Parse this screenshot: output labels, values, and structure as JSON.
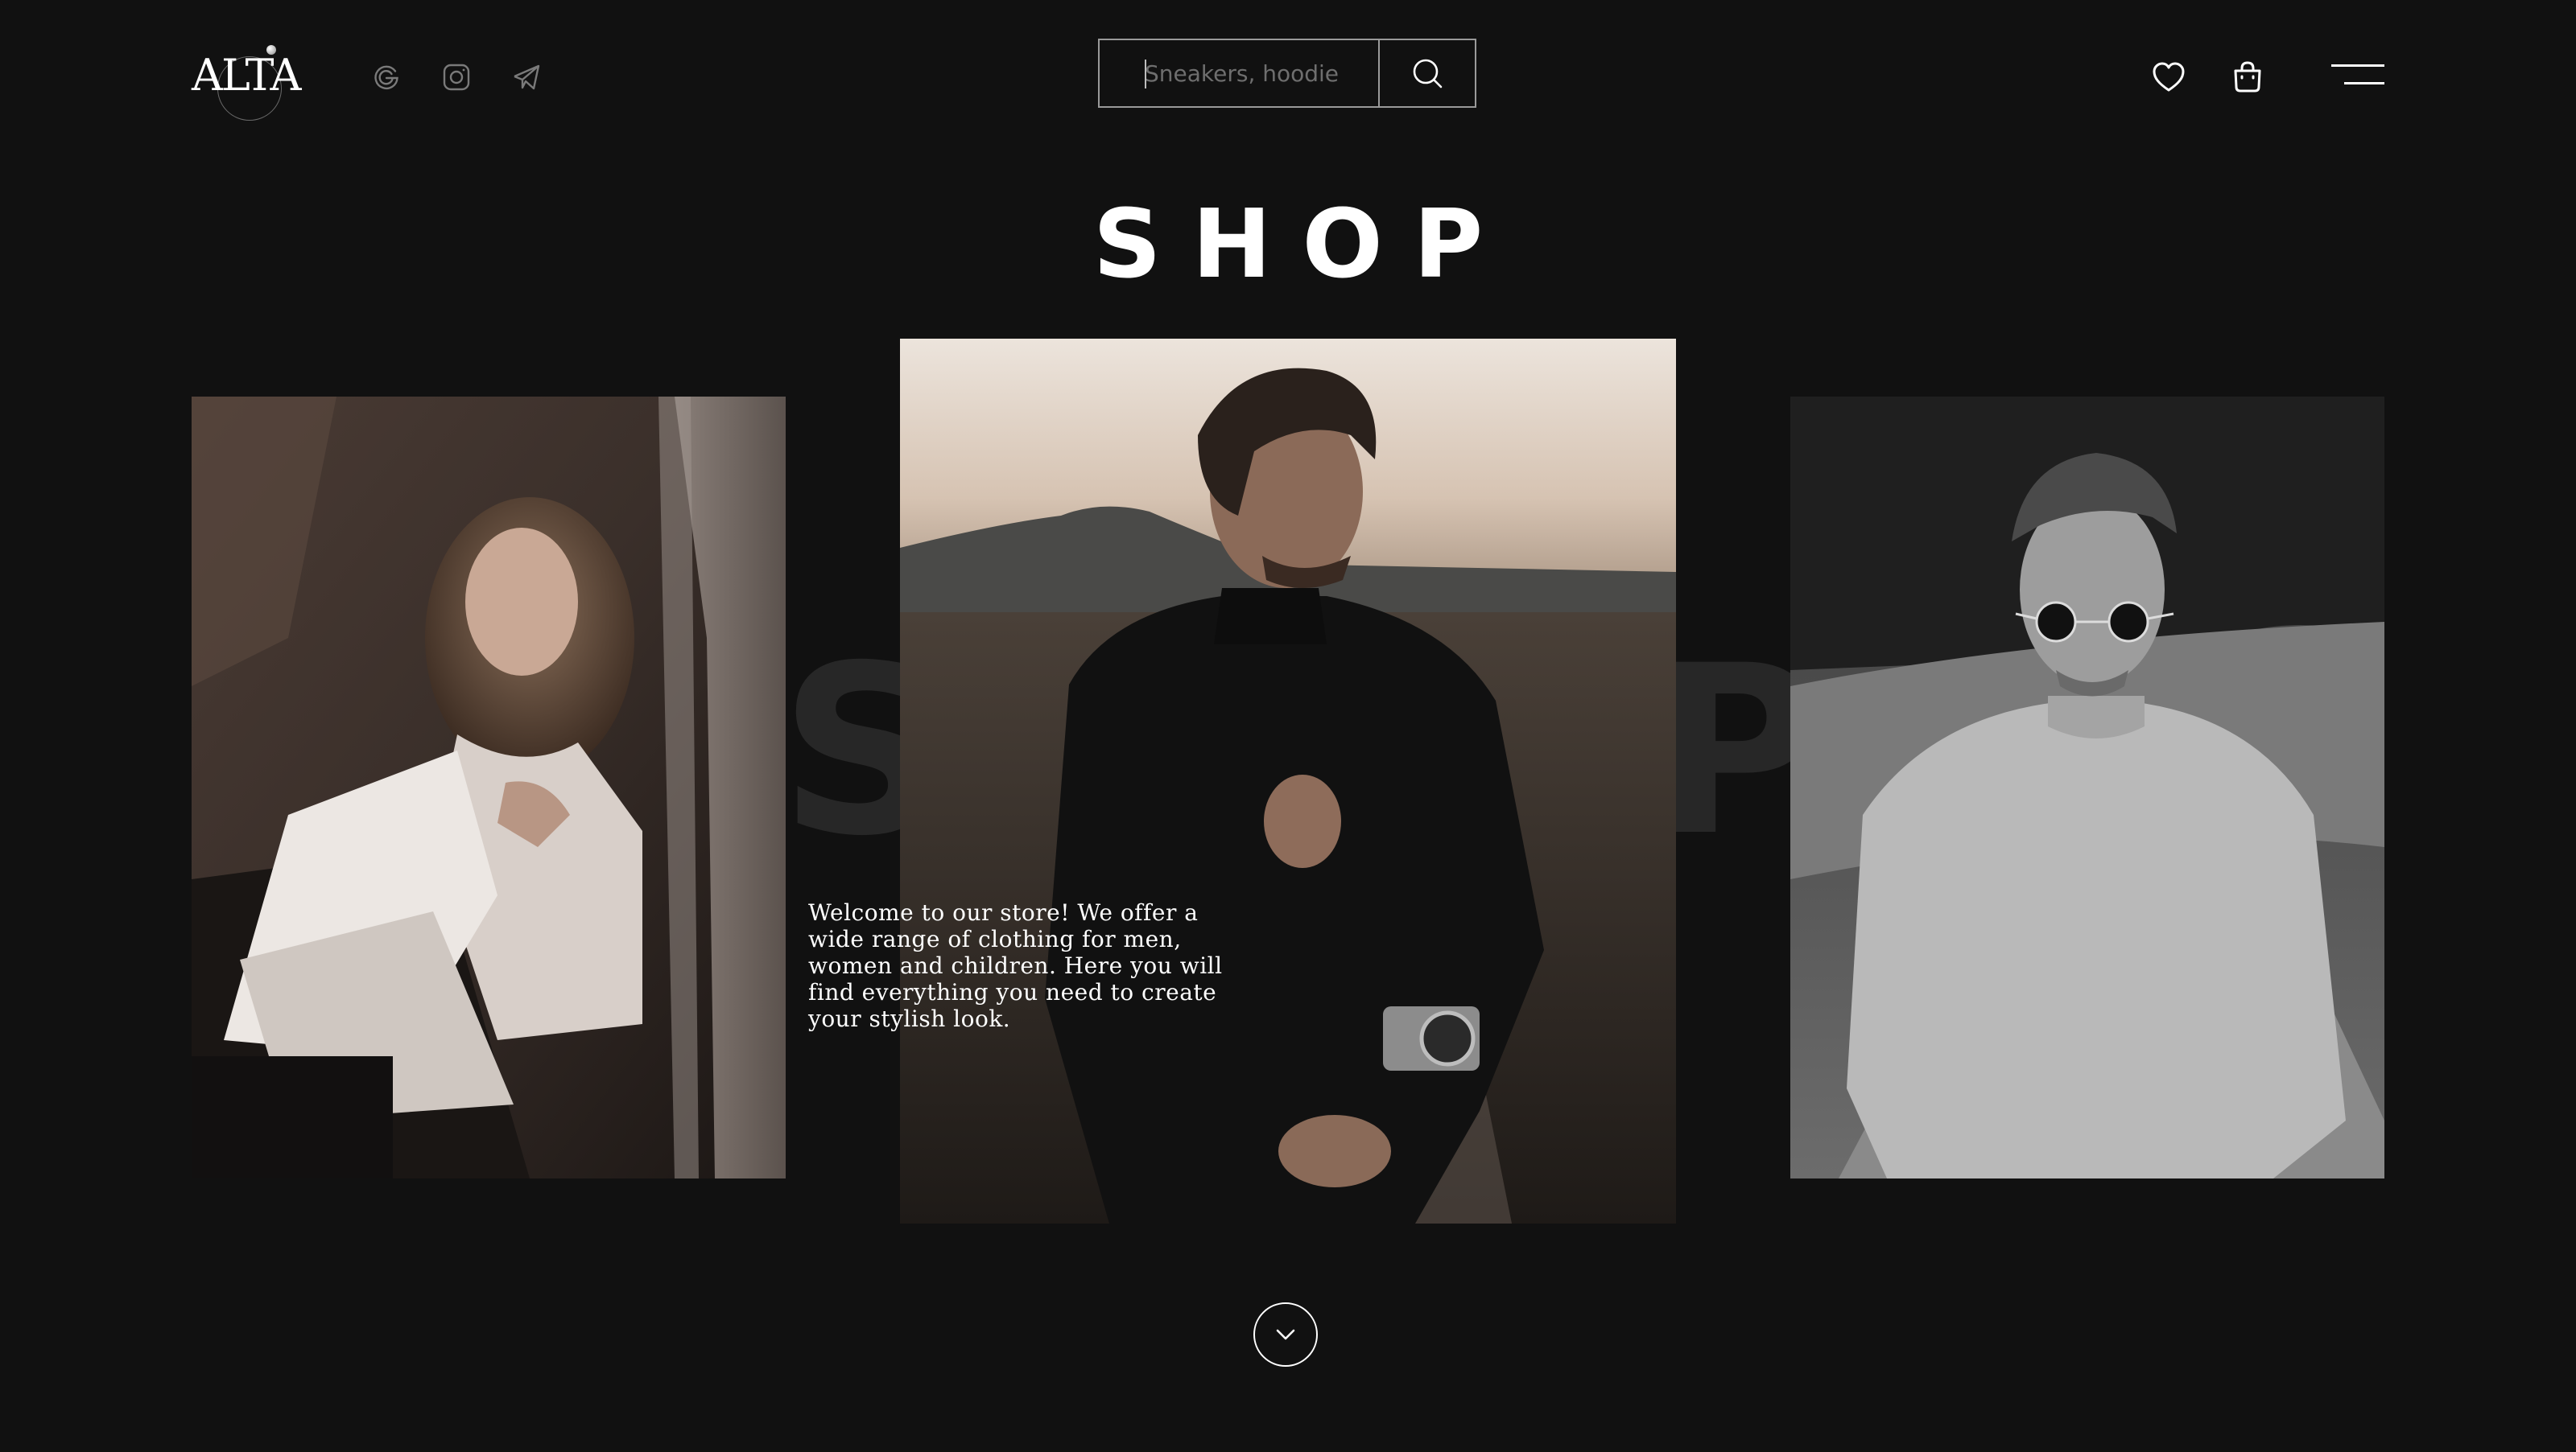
{
  "header": {
    "logo_text": "ALTA",
    "social_icons": [
      "google-icon",
      "instagram-icon",
      "telegram-icon"
    ],
    "search": {
      "placeholder": "Sneakers, hoodie",
      "value": "",
      "button_icon": "search-icon"
    },
    "actions": [
      "heart-icon",
      "bag-icon",
      "menu-icon"
    ]
  },
  "main": {
    "title": "SHOP",
    "background_letters": [
      "S",
      "P"
    ],
    "welcome_text": "Welcome to our store! We offer a wide range of clothing for men, women and children. Here you will find everything you need to create your stylish look.",
    "scroll_button_icon": "chevron-down-icon"
  },
  "colors": {
    "background": "#111111",
    "text": "#ffffff",
    "muted_icon": "#7a7a7a",
    "border": "#9a9a9a",
    "background_letters": "#272727"
  }
}
